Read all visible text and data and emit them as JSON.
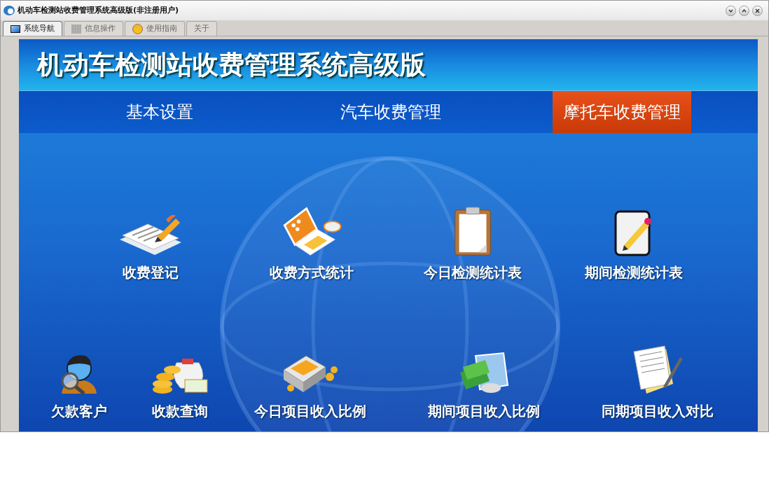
{
  "window": {
    "title": "机动车检测站收费管理系统高级版(非注册用户)"
  },
  "tabs": [
    {
      "label": "系统导航",
      "selected": true
    },
    {
      "label": "信息操作",
      "selected": false
    },
    {
      "label": "使用指南",
      "selected": false
    },
    {
      "label": "关于",
      "selected": false
    }
  ],
  "banner": {
    "title": "机动车检测站收费管理系统高级版"
  },
  "nav": [
    {
      "label": "基本设置",
      "selected": false
    },
    {
      "label": "汽车收费管理",
      "selected": false
    },
    {
      "label": "摩托车收费管理",
      "selected": true
    }
  ],
  "functions_row_1": [
    {
      "label": "收费登记"
    },
    {
      "label": "收费方式统计"
    },
    {
      "label": "今日检测统计表"
    },
    {
      "label": "期间检测统计表"
    }
  ],
  "functions_row_2": [
    {
      "label": "欠款客户"
    },
    {
      "label": "收款查询"
    },
    {
      "label": "今日项目收入比例"
    },
    {
      "label": "期间项目收入比例"
    },
    {
      "label": "同期项目收入对比"
    }
  ]
}
